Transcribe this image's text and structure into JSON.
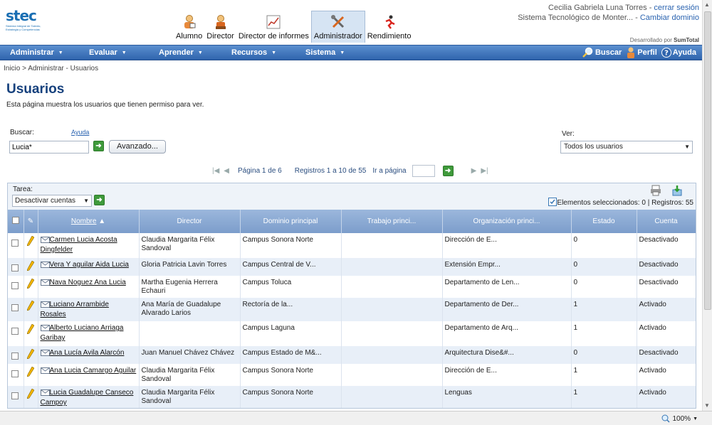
{
  "header": {
    "logo_text": "stec",
    "logo_subtext": "Sistema Integral de Talento, Estrategia y Competencias",
    "user_name": "Cecilia Gabriela Luna Torres",
    "logout": "cerrar sesión",
    "domain": "Sistema Tecnológico de Monter...",
    "change_domain": "Cambiar dominio",
    "developed_by_prefix": "Desarrollado por",
    "developed_by_brand": "SumTotal",
    "roles": [
      {
        "label": "Alumno"
      },
      {
        "label": "Director"
      },
      {
        "label": "Director de informes"
      },
      {
        "label": "Administrador"
      },
      {
        "label": "Rendimiento"
      }
    ]
  },
  "menu": {
    "items": [
      "Administrar",
      "Evaluar",
      "Aprender",
      "Recursos",
      "Sistema"
    ],
    "search": "Buscar",
    "profile": "Perfil",
    "help": "Ayuda"
  },
  "breadcrumb": "Inicio > Administrar - Usuarios",
  "page": {
    "title": "Usuarios",
    "description": "Esta página muestra los usuarios que tienen permiso para ver."
  },
  "search": {
    "label": "Buscar:",
    "help": "Ayuda",
    "value": "Lucia*",
    "advanced": "Avanzado..."
  },
  "view": {
    "label": "Ver:",
    "selected": "Todos los usuarios"
  },
  "pager": {
    "page_text": "Página 1 de 6",
    "records_text": "Registros 1 a 10 de 55",
    "goto_label": "Ir a página"
  },
  "grid": {
    "task_label": "Tarea:",
    "task_selected": "Desactivar cuentas",
    "selection_info": "Elementos seleccionados: 0 | Registros: 55",
    "columns": [
      "Nombre",
      "Director",
      "Dominio principal",
      "Trabajo princi...",
      "Organización princi...",
      "Estado",
      "Cuenta"
    ],
    "rows": [
      {
        "name": "Carmen Lucia Acosta Dingfelder",
        "director": "Claudia Margarita Félix Sandoval",
        "domain": "Campus Sonora Norte",
        "job": "",
        "org": "Dirección de E...",
        "state": "0",
        "account": "Desactivado"
      },
      {
        "name": "Vera Y aguilar Aida Lucia",
        "director": "Gloria Patricia Lavin Torres",
        "domain": "Campus Central de V...",
        "job": "",
        "org": "Extensión Empr...",
        "state": "0",
        "account": "Desactivado"
      },
      {
        "name": "Nava Noguez Ana Lucia",
        "director": "Martha Eugenia Herrera Echauri",
        "domain": "Campus Toluca",
        "job": "",
        "org": "Departamento de Len...",
        "state": "0",
        "account": "Desactivado"
      },
      {
        "name": "Luciano Arrambide Rosales",
        "director": "Ana María de Guadalupe Alvarado Larios",
        "domain": "Rectoría de la...",
        "job": "",
        "org": "Departamento de Der...",
        "state": "1",
        "account": "Activado"
      },
      {
        "name": "Alberto Luciano Arriaga Garibay",
        "director": "",
        "domain": "Campus Laguna",
        "job": "",
        "org": "Departamento de Arq...",
        "state": "1",
        "account": "Activado"
      },
      {
        "name": "Ana Lucía Avila Alarcón",
        "director": "Juan Manuel Chávez Chávez",
        "domain": "Campus Estado de M&...",
        "job": "",
        "org": "Arquitectura Dise&#...",
        "state": "0",
        "account": "Desactivado"
      },
      {
        "name": "Ana Lucia Camargo Aguilar",
        "director": "Claudia Margarita Félix Sandoval",
        "domain": "Campus Sonora Norte",
        "job": "",
        "org": "Dirección de E...",
        "state": "1",
        "account": "Activado"
      },
      {
        "name": "Lucia Guadalupe Canseco Campoy",
        "director": "Claudia Margarita Félix Sandoval",
        "domain": "Campus Sonora Norte",
        "job": "",
        "org": "Lenguas",
        "state": "1",
        "account": "Activado"
      }
    ]
  },
  "status": {
    "zoom": "100%"
  }
}
